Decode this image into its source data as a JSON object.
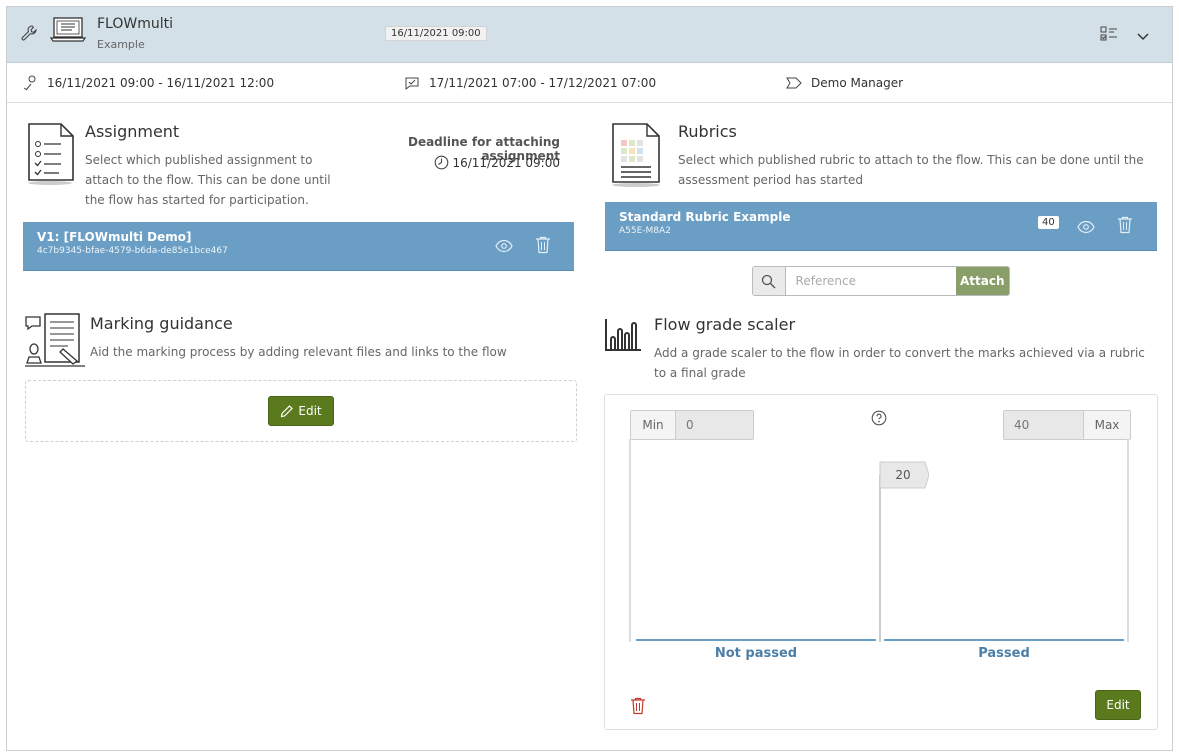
{
  "header": {
    "title": "FLOWmulti",
    "subtitle": "Example",
    "date": "16/11/2021 09:00"
  },
  "info": {
    "participation": "16/11/2021 09:00 - 16/11/2021 12:00",
    "assessment": "17/11/2021 07:00 - 17/12/2021 07:00",
    "manager": "Demo Manager"
  },
  "assignment": {
    "title": "Assignment",
    "description": "Select which published assignment to attach to the flow. This can be done until the flow has started for participation.",
    "deadline_label": "Deadline for attaching assignment",
    "deadline_value": "16/11/2021 09:00",
    "item_title": "V1: [FLOWmulti Demo]",
    "item_id": "4c7b9345-bfae-4579-b6da-de85e1bce467"
  },
  "rubrics": {
    "title": "Rubrics",
    "description": "Select which published rubric to attach to the flow. This can be done until the assessment period has started",
    "item_title": "Standard Rubric Example",
    "item_id": "A55E-M8A2",
    "badge": "40",
    "search_placeholder": "Reference",
    "attach_label": "Attach"
  },
  "guidance": {
    "title": "Marking guidance",
    "description": "Aid the marking process by adding relevant files and links to the flow",
    "edit_label": "Edit"
  },
  "scaler": {
    "title": "Flow grade scaler",
    "description": "Add a grade scaler to the flow in order to convert the marks achieved via a rubric to a final grade",
    "min_label": "Min",
    "min_value": "0",
    "max_label": "Max",
    "max_value": "40",
    "threshold": "20",
    "grade_low": "Not passed",
    "grade_high": "Passed",
    "edit_label": "Edit"
  }
}
